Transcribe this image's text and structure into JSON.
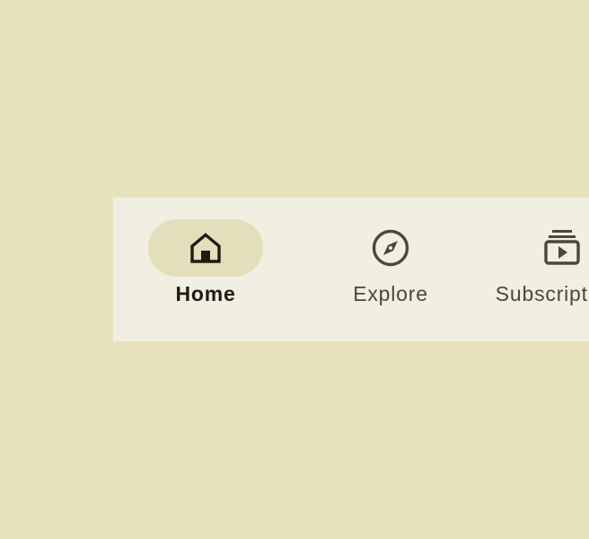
{
  "nav": {
    "items": [
      {
        "label": "Home",
        "icon": "home-icon",
        "active": true
      },
      {
        "label": "Explore",
        "icon": "explore-compass-icon",
        "active": false
      },
      {
        "label": "Subscriptions",
        "icon": "subscriptions-icon",
        "active": false
      }
    ]
  },
  "colors": {
    "background": "#e6e2bd",
    "nav_surface": "#f1efe1",
    "active_indicator": "#e3dfbb",
    "active_text": "#1d1c12",
    "inactive_text": "#4a4836"
  }
}
